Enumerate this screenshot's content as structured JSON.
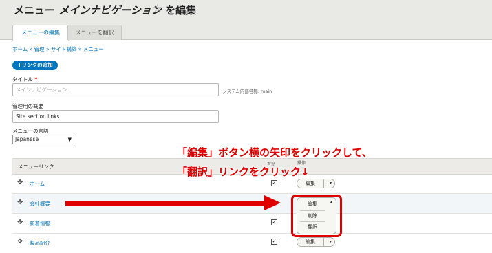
{
  "header": {
    "title_prefix": "メニュー ",
    "title_menu_name": "メインナビゲーション",
    "title_suffix": " を編集",
    "star": "☆",
    "tabs": [
      "メニューの編集",
      "メニューを翻訳"
    ]
  },
  "breadcrumb": "ホーム » 管理 » サイト構築 » メニュー",
  "add_link_button": "+リンクの追加",
  "form": {
    "title_label": "タイトル",
    "required_mark": "*",
    "title_value": "メインナビゲーション",
    "machine_name": "システム内部名称: main",
    "description_label": "管理用の概要",
    "description_value": "Site section links",
    "language_label": "メニューの言語",
    "language_value": "Japanese"
  },
  "table": {
    "headers": {
      "menu_link": "メニューリンク",
      "enabled": "有効",
      "operations": "操作"
    },
    "rows": [
      {
        "label": "ホーム",
        "enabled": true,
        "operation": "編集"
      },
      {
        "label": "会社概要",
        "enabled": true,
        "operation": "編集"
      },
      {
        "label": "新着情報",
        "enabled": true,
        "operation": ""
      },
      {
        "label": "製品紹介",
        "enabled": true,
        "operation": "編集"
      }
    ],
    "dropdown_items": [
      "編集",
      "削除",
      "翻訳"
    ]
  },
  "annotation": {
    "line1": "「編集」ボタン横の矢印をクリックして、",
    "line2": "「翻訳」リンクをクリック↓",
    "color": "#e00000"
  },
  "colors": {
    "link": "#0074bd",
    "primary_button": "#0074bd",
    "header_bg": "#e9e9e6"
  },
  "icons": {
    "star": "star-outline-icon",
    "drag": "drag-handle-icon",
    "check": "checkbox-checked-icon",
    "dropdown": "chevron-down-icon"
  }
}
